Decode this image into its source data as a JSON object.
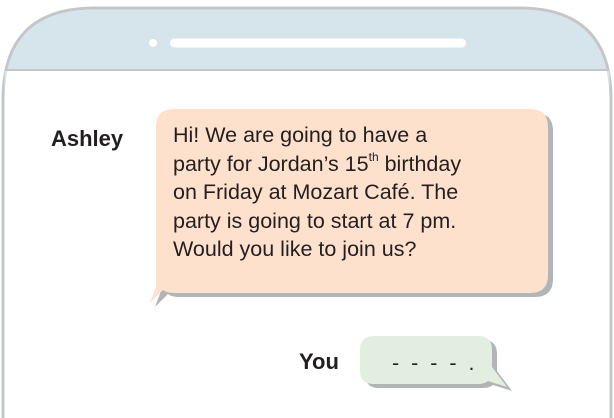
{
  "colors": {
    "header_bar": "#d6e5ec",
    "phone_outline": "#c4c7c9",
    "incoming_bubble": "#fde1cd",
    "outgoing_bubble": "#e2efe0",
    "bubble_shadow": "#b2b5b8",
    "text": "#231f20"
  },
  "icons": {
    "camera": "camera-dot-icon",
    "speaker": "speaker-slot-icon"
  },
  "conversation": {
    "incoming": {
      "sender": "Ashley",
      "lines": [
        {
          "text": "Hi! We are going to have a"
        },
        {
          "before": "party for Jordan’s 15",
          "sup": "th",
          "after": " birthday"
        },
        {
          "text": "on Friday at Mozart Café. The"
        },
        {
          "text": "party is going to start at 7 pm."
        },
        {
          "text": "Would you like to join us?"
        }
      ]
    },
    "outgoing": {
      "sender": "You",
      "text": "- - - - ."
    }
  }
}
